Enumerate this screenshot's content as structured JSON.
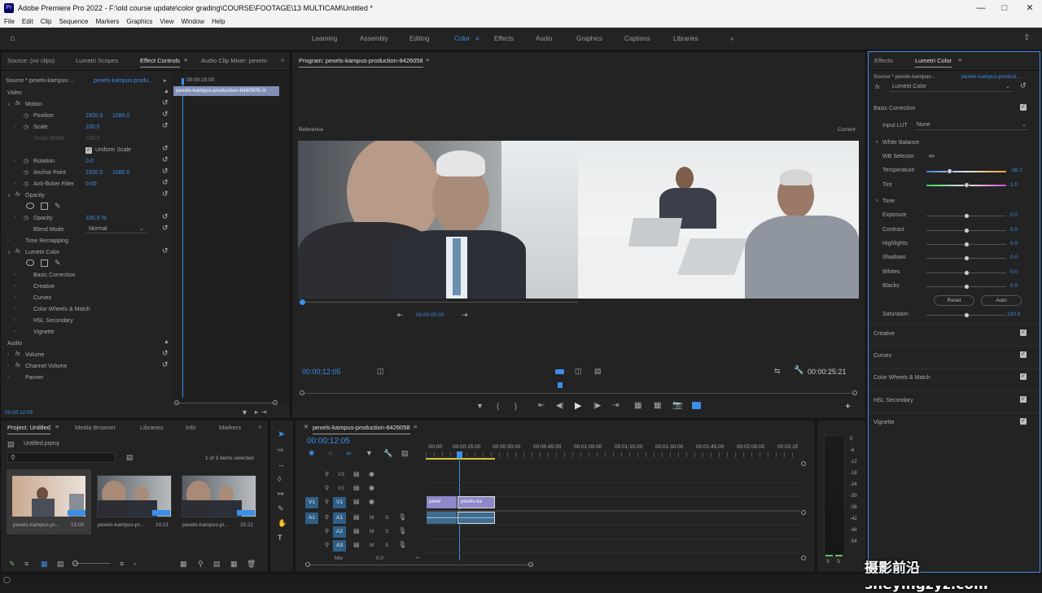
{
  "window": {
    "title": "Adobe Premiere Pro 2022 - F:\\old course update\\color grading\\COURSE\\FOOTAGE\\13 MULTICAM\\Untitled *",
    "logo": "Pr"
  },
  "menu": [
    "File",
    "Edit",
    "Clip",
    "Sequence",
    "Markers",
    "Graphics",
    "View",
    "Window",
    "Help"
  ],
  "workspaces": [
    "Learning",
    "Assembly",
    "Editing",
    "Color",
    "Effects",
    "Audio",
    "Graphics",
    "Captions",
    "Libraries"
  ],
  "active_workspace": "Color",
  "effect_panel": {
    "tabs": [
      "Source: (no clips)",
      "Lumetri Scopes",
      "Effect Controls",
      "Audio Clip Mixer: pexels-"
    ],
    "source_label": "Source * pexels-kampus-...",
    "clip_link": "pexels-kampus-produ...",
    "timecode_head": "00:00:15:00",
    "clip_bar": "pexels-kampus-production-8460905.m",
    "video_header": "Video",
    "motion": "Motion",
    "position": "Position",
    "position_x": "1920.0",
    "position_y": "1080.0",
    "scale": "Scale",
    "scale_val": "100.0",
    "scale_width": "Scale Width",
    "scale_width_val": "100.0",
    "uniform_scale": "Uniform Scale",
    "rotation": "Rotation",
    "rotation_val": "0.0",
    "anchor": "Anchor Point",
    "anchor_x": "1920.0",
    "anchor_y": "1080.0",
    "antiflicker": "Anti-flicker Filter",
    "antiflicker_val": "0.00",
    "opacity_group": "Opacity",
    "opacity": "Opacity",
    "opacity_val": "100.0 %",
    "blend": "Blend Mode",
    "blend_val": "Normal",
    "time_remap": "Time Remapping",
    "lumetri": "Lumetri Color",
    "sub": [
      "Basic Correction",
      "Creative",
      "Curves",
      "Color Wheels & Match",
      "HSL Secondary",
      "Vignette"
    ],
    "audio_header": "Audio",
    "volume": "Volume",
    "channel_volume": "Channel Volume",
    "panner": "Panner",
    "timecode": "00:00:12:05"
  },
  "program": {
    "title": "Program: pexels-kampus-production-8426058",
    "reference": "Reference",
    "current": "Current",
    "ref_timecode": "00:00:00:00",
    "timecode": "00:00:12:05",
    "duration": "00:00:25:21"
  },
  "project": {
    "tabs": [
      "Project: Untitled",
      "Media Browser",
      "Libraries",
      "Info",
      "Markers"
    ],
    "file": "Untitled.prproj",
    "selected": "1 of 3 items selected",
    "items": [
      {
        "name": "pexels-kampus-pr...",
        "dur": "15:00"
      },
      {
        "name": "pexels-kampus-pr...",
        "dur": "10:21"
      },
      {
        "name": "pexels-kampus-pr...",
        "dur": "25:21"
      }
    ]
  },
  "timeline": {
    "title": "pexels-kampus-production-8426058",
    "timecode": "00:00:12:05",
    "ruler": [
      ":00:00",
      "00:00:15:00",
      "00:00:30:00",
      "00:00:45:00",
      "00:01:00:00",
      "00:01:15:00",
      "00:01:30:00",
      "00:01:45:00",
      "00:02:00:00",
      "00:02:15"
    ],
    "tracks": [
      "V3",
      "V2",
      "V1",
      "A1",
      "A2",
      "A3"
    ],
    "mix_label": "Mix",
    "mix_val": "0.0",
    "clip_v1a": "pexel",
    "clip_v1b": "pexels-ka"
  },
  "meter": [
    "0",
    "-6",
    "-12",
    "-18",
    "-24",
    "-30",
    "-36",
    "-42",
    "-48",
    "-54"
  ],
  "meter_solo": [
    "S",
    "S"
  ],
  "lumetri": {
    "tabs": [
      "Effects",
      "Lumetri Color"
    ],
    "source_label": "Source * pexels-kampus-...",
    "clip_link": "pexels-kampus-product...",
    "fx_name": "Lumetri Color",
    "basic": "Basic Correction",
    "input_lut": "Input LUT",
    "lut_val": "None",
    "white_balance": "White Balance",
    "wb_selector": "WB Selector",
    "temperature": "Temperature",
    "temp_val": "-38.2",
    "tint": "Tint",
    "tint_val": "1.0",
    "tone": "Tone",
    "tone_rows": [
      {
        "label": "Exposure",
        "val": "0.0"
      },
      {
        "label": "Contrast",
        "val": "0.0"
      },
      {
        "label": "Highlights",
        "val": "0.0"
      },
      {
        "label": "Shadows",
        "val": "0.0"
      },
      {
        "label": "Whites",
        "val": "0.0"
      },
      {
        "label": "Blacks",
        "val": "0.0"
      }
    ],
    "reset": "Reset",
    "auto": "Auto",
    "saturation": "Saturation",
    "sat_val": "100.0",
    "sections": [
      "Creative",
      "Curves",
      "Color Wheels & Match",
      "HSL Secondary",
      "Vignette"
    ]
  },
  "watermark": "摄影前沿 sheyingzyz.com",
  "colors": {
    "accent": "#3d8ee6",
    "panel": "#232323",
    "bg": "#1d1d1d"
  }
}
